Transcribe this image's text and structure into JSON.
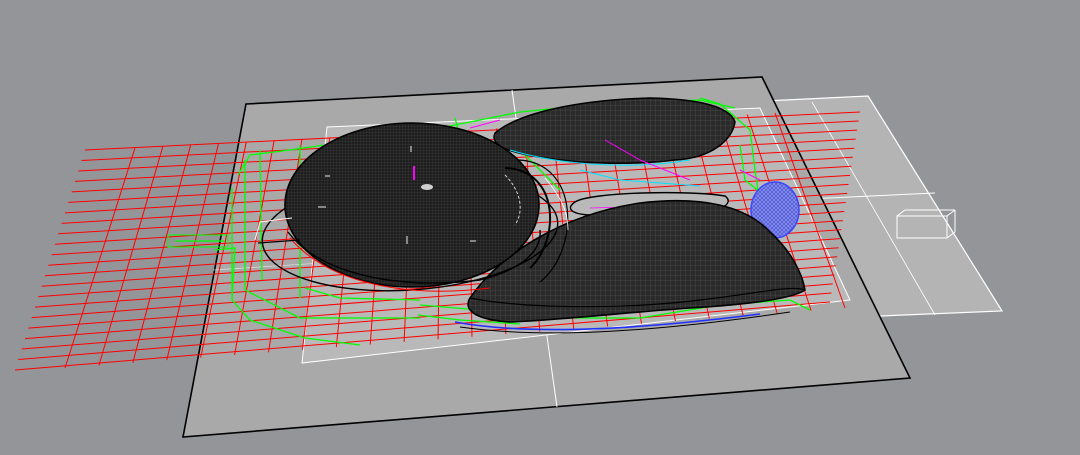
{
  "viewport": {
    "background": "#939599",
    "projection": "perspective"
  },
  "colors": {
    "ground_plane": "#a9a9a9",
    "secondary_plane": "#b4b4b4",
    "inner_plane": "#b9b9b9",
    "mesh_fill": "#2a2a2a",
    "mesh_line": "#5a5a5a",
    "outline": "#000000",
    "grid_red": "#ff0000",
    "curves_green": "#00ff00",
    "curves_blue": "#2030ff",
    "curves_magenta": "#ff00ff",
    "curves_cyan": "#00e0ff",
    "white_lines": "#ffffff"
  },
  "objects": [
    {
      "name": "ground-plane",
      "kind": "planar surface"
    },
    {
      "name": "secondary-plane",
      "kind": "planar surface"
    },
    {
      "name": "round-hall-mesh",
      "kind": "mesh dome"
    },
    {
      "name": "upper-leaf-mesh",
      "kind": "mesh shell"
    },
    {
      "name": "lower-leaf-mesh",
      "kind": "mesh shell"
    },
    {
      "name": "red-grid",
      "kind": "curves"
    },
    {
      "name": "green-site-curves",
      "kind": "curves"
    },
    {
      "name": "blue-circle-marker",
      "kind": "curves"
    },
    {
      "name": "small-box-wireframe",
      "kind": "wireframe box"
    }
  ]
}
